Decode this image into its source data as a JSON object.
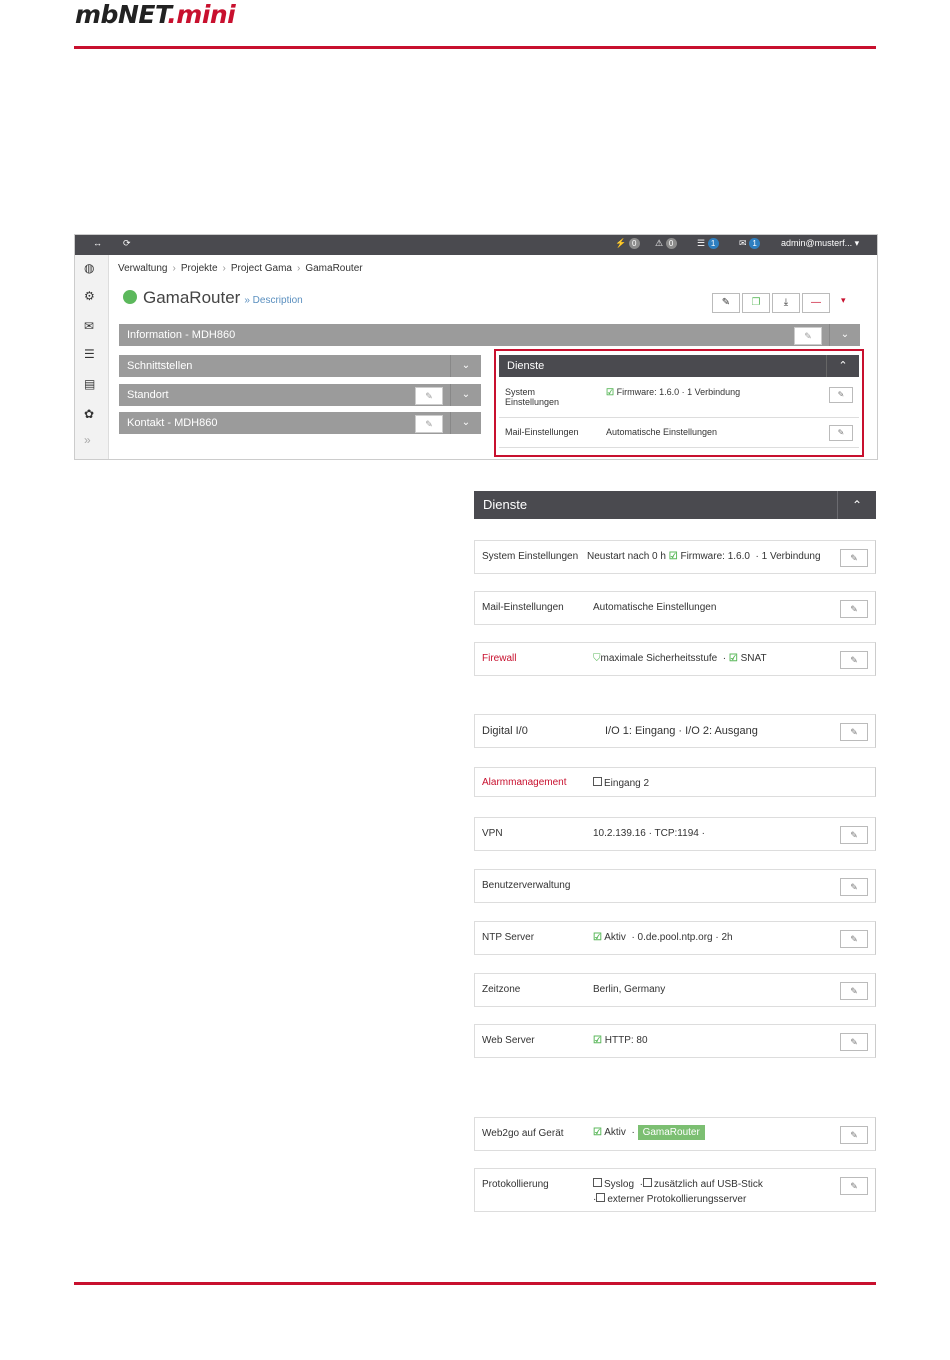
{
  "header": {
    "logo_prefix": "mbNET",
    "logo_suffix": ".mini"
  },
  "screenshot": {
    "topbar": {
      "expand_icon": "↔",
      "refresh_icon": "⟳",
      "badge_alerts": "0",
      "badge_warnings": "0",
      "badge_list": "1",
      "badge_mail": "1",
      "user": "admin@musterf..."
    },
    "breadcrumb": [
      "Verwaltung",
      "Projekte",
      "Project Gama",
      "GamaRouter"
    ],
    "device_name": "GamaRouter",
    "device_desc": "» Description",
    "panels": {
      "information": "Information - MDH860",
      "schnittstellen": "Schnittstellen",
      "standort": "Standort",
      "kontakt": "Kontakt - MDH860"
    },
    "dienste_title": "Dienste",
    "mini_rows": [
      {
        "label": "System Einstellungen",
        "value": "Firmware: 1.6.0  · 1 Verbindung"
      },
      {
        "label": "Mail-Einstellungen",
        "value": "Automatische Einstellungen"
      }
    ]
  },
  "dienste": {
    "title": "Dienste",
    "system": {
      "label": "System Einstellungen",
      "v1": "Neustart nach 0 h",
      "v2": "Firmware: 1.6.0",
      "v3": "· 1 Verbindung"
    },
    "mail": {
      "label": "Mail-Einstellungen",
      "value": "Automatische Einstellungen"
    },
    "firewall": {
      "label": "Firewall",
      "v1": "maximale Sicherheitsstufe",
      "v2": "SNAT"
    },
    "digital": {
      "label": "Digital I/0",
      "value": "I/O 1: Eingang  · I/O 2: Ausgang"
    },
    "alarm": {
      "label": "Alarmmanagement",
      "value": "Eingang 2"
    },
    "vpn": {
      "label": "VPN",
      "value": "10.2.139.16   · TCP:1194   ·"
    },
    "benutzer": {
      "label": "Benutzerverwaltung"
    },
    "ntp": {
      "label": "NTP Server",
      "v1": "Aktiv",
      "v2": "· 0.de.pool.ntp.org   · 2h"
    },
    "zeitzone": {
      "label": "Zeitzone",
      "value": "Berlin, Germany"
    },
    "web": {
      "label": "Web Server",
      "value": "HTTP: 80"
    },
    "web2go": {
      "label": "Web2go auf Gerät",
      "v1": "Aktiv",
      "sep": "·",
      "tag": "GamaRouter"
    },
    "protokoll": {
      "label": "Protokollierung",
      "v1": "Syslog",
      "v2": "zusätzlich auf USB-Stick",
      "v3": "externer Protokollierungsserver"
    }
  }
}
